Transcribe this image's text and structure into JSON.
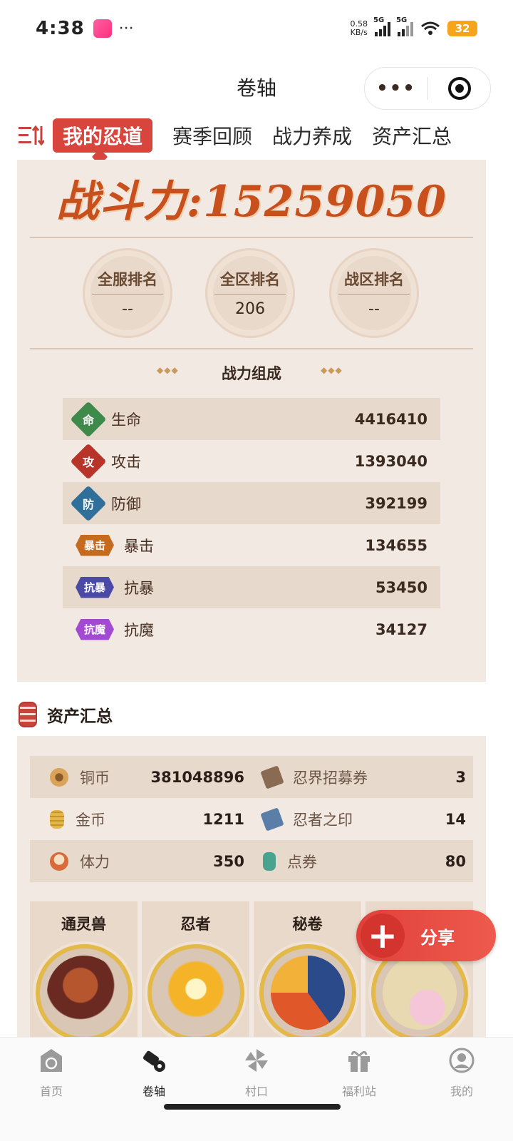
{
  "status": {
    "time": "4:38",
    "app_badge": "bilibili",
    "dots": "···",
    "speed_top": "0.58",
    "speed_bottom": "KB/s",
    "net1": "5G",
    "net2": "5G",
    "battery": "32"
  },
  "header": {
    "title": "卷轴",
    "more": "•••"
  },
  "tabs": [
    {
      "label": "我的忍道",
      "active": true
    },
    {
      "label": "赛季回顾",
      "active": false
    },
    {
      "label": "战力养成",
      "active": false
    },
    {
      "label": "资产汇总",
      "active": false
    }
  ],
  "power": {
    "value": "战斗力:15259050",
    "ranks": [
      {
        "label": "全服排名",
        "value": "--"
      },
      {
        "label": "全区排名",
        "value": "206"
      },
      {
        "label": "战区排名",
        "value": "--"
      }
    ],
    "composition_title": "战力组成",
    "diamonds": "◆◆◆",
    "stats": [
      {
        "icon": "命",
        "name": "生命",
        "value": "4416410",
        "color": "#3e8a4a"
      },
      {
        "icon": "攻",
        "name": "攻击",
        "value": "1393040",
        "color": "#b8342b"
      },
      {
        "icon": "防",
        "name": "防御",
        "value": "392199",
        "color": "#2f6f9a"
      },
      {
        "icon": "暴击",
        "name": "暴击",
        "value": "134655",
        "color": "#c66a1d"
      },
      {
        "icon": "抗暴",
        "name": "抗暴",
        "value": "53450",
        "color": "#4a4aa6"
      },
      {
        "icon": "抗魔",
        "name": "抗魔",
        "value": "34127",
        "color": "#a24ad2"
      }
    ]
  },
  "assets": {
    "title": "资产汇总",
    "rows": [
      [
        {
          "name": "铜币",
          "value": "381048896",
          "icon_color": "#b47a3a"
        },
        {
          "name": "忍界招募券",
          "value": "3",
          "icon_color": "#8a6a52"
        }
      ],
      [
        {
          "name": "金币",
          "value": "1211",
          "icon_color": "#e3b84a"
        },
        {
          "name": "忍者之印",
          "value": "14",
          "icon_color": "#5a7ea8"
        }
      ],
      [
        {
          "name": "体力",
          "value": "350",
          "icon_color": "#d96a3a"
        },
        {
          "name": "点券",
          "value": "80",
          "icon_color": "#4aa38e"
        }
      ]
    ],
    "cards": [
      {
        "title": "通灵兽"
      },
      {
        "title": "忍者"
      },
      {
        "title": "秘卷"
      },
      {
        "title": ""
      }
    ]
  },
  "share": {
    "label": "分享",
    "plus": "+"
  },
  "nav": [
    {
      "label": "首页",
      "icon": "home-icon",
      "active": false
    },
    {
      "label": "卷轴",
      "icon": "scroll-icon",
      "active": true
    },
    {
      "label": "村口",
      "icon": "pinwheel-icon",
      "active": false
    },
    {
      "label": "福利站",
      "icon": "gift-icon",
      "active": false
    },
    {
      "label": "我的",
      "icon": "profile-icon",
      "active": false
    }
  ]
}
